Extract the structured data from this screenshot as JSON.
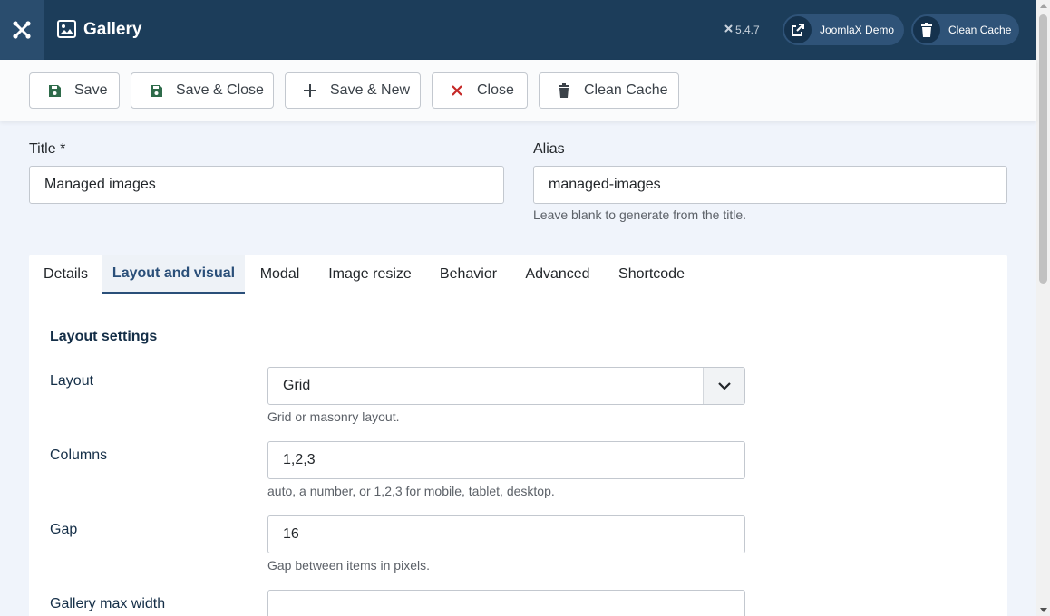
{
  "header": {
    "title": "Gallery",
    "version": "5.4.7",
    "demo_label": "JoomlaX Demo",
    "cache_label": "Clean Cache"
  },
  "toolbar": {
    "save": "Save",
    "save_close": "Save & Close",
    "save_new": "Save & New",
    "close": "Close",
    "clean_cache": "Clean Cache"
  },
  "form": {
    "title_label": "Title *",
    "title_value": "Managed images",
    "alias_label": "Alias",
    "alias_value": "managed-images",
    "alias_hint": "Leave blank to generate from the title."
  },
  "tabs": [
    {
      "label": "Details"
    },
    {
      "label": "Layout and visual"
    },
    {
      "label": "Modal"
    },
    {
      "label": "Image resize"
    },
    {
      "label": "Behavior"
    },
    {
      "label": "Advanced"
    },
    {
      "label": "Shortcode"
    }
  ],
  "active_tab": "Layout and visual",
  "layout_settings": {
    "section_title": "Layout settings",
    "layout_label": "Layout",
    "layout_value": "Grid",
    "layout_hint": "Grid or masonry layout.",
    "columns_label": "Columns",
    "columns_value": "1,2,3",
    "columns_hint": "auto, a number, or 1,2,3 for mobile, tablet, desktop.",
    "gap_label": "Gap",
    "gap_value": "16",
    "gap_hint": "Gap between items in pixels.",
    "max_width_label": "Gallery max width",
    "max_width_value": ""
  },
  "colors": {
    "header_bg": "#1c3d5a",
    "accent": "#2a4f79",
    "save_green": "#2e6b4a",
    "close_red": "#c52827"
  }
}
